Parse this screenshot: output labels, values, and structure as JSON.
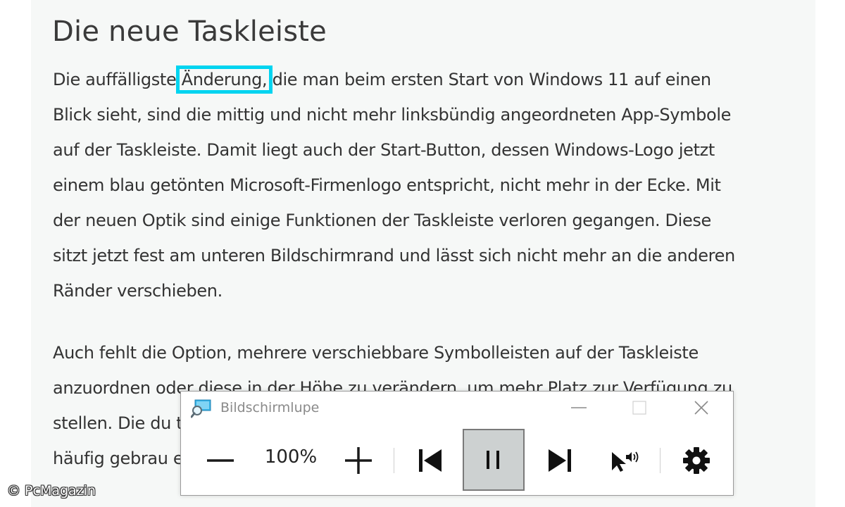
{
  "article": {
    "title": "Die neue Taskleiste",
    "paragraph1": {
      "line1_before": "Die auffälligste ",
      "line1_highlight": "Änderung,",
      "line1_after": " die man beim ersten Start von Windows 11 auf einen",
      "lines": [
        "Blick sieht, sind die mittig und nicht mehr linksbündig angeordneten App-Symbole",
        "auf der Taskleiste. Damit liegt auch der Start-Button, dessen Windows-Logo jetzt",
        "einem blau getönten Microsoft-Firmenlogo entspricht, nicht mehr in der Ecke. Mit",
        "der neuen Optik sind einige Funktionen der Taskleiste verloren gegangen. Diese",
        "sitzt jetzt fest am unteren Bildschirmrand und lässt sich nicht mehr an die anderen",
        "Ränder verschieben."
      ]
    },
    "paragraph2": {
      "lines": [
        "Auch fehlt die Option, mehrere verschiebbare Symbolleisten auf der Taskleiste",
        "anzuordnen oder diese in der Höhe zu verändern, um mehr Platz zur Verfügung zu",
        "stellen. Die du                                                                                        t,",
        "häufig gebrau                                                                                      efallen."
      ]
    }
  },
  "magnifier": {
    "title": "Bildschirmlupe",
    "zoom_level": "100%",
    "buttons": {
      "zoom_out": "zoom-out",
      "zoom_in": "zoom-in",
      "previous": "previous-paragraph",
      "pause": "pause",
      "next": "next-paragraph",
      "read_from_here": "read-from-here",
      "settings": "settings"
    },
    "colors": {
      "pause_bg": "#cdd1d1",
      "focus_outline": "#00d4f0"
    }
  },
  "watermark": "© PcMagazin"
}
